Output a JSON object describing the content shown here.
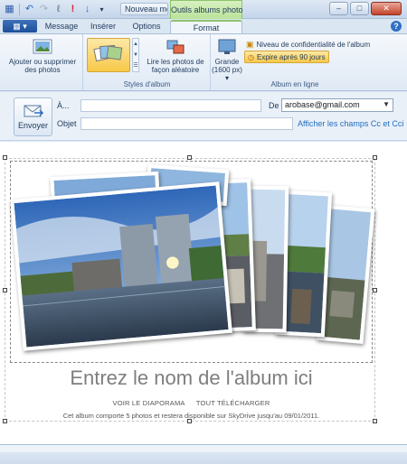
{
  "title_bar": {
    "app_title": "Nouveau me...",
    "context_title": "Outils albums photo"
  },
  "tabs": {
    "message": "Message",
    "inserer": "Insérer",
    "options": "Options",
    "format": "Format"
  },
  "ribbon": {
    "add_remove_label": "Ajouter ou supprimer des photos",
    "styles_group_label": "Styles d'album",
    "random_label": "Lire les photos de façon aléatoire",
    "size_label": "Grande (1600 px)",
    "privacy_label": "Niveau de confidentialité de l'album",
    "expire_label": "Expire après 90 jours",
    "online_group_label": "Album en ligne"
  },
  "header": {
    "send_label": "Envoyer",
    "to_label": "À...",
    "subject_label": "Objet",
    "from_label": "De",
    "from_value": "arobase@gmail.com",
    "cc_link": "Afficher les champs Cc et Cci"
  },
  "album": {
    "title_placeholder": "Entrez le nom de l'album ici",
    "slideshow_link": "VOIR LE DIAPORAMA",
    "download_link": "TOUT TÉLÉCHARGER",
    "note": "Cet album comporte 5 photos et restera disponible sur SkyDrive jusqu'au 09/01/2011."
  },
  "colors": {
    "accent": "#1d4f9b",
    "context_tab": "#b9e39a",
    "link": "#1f6dc0",
    "highlight": "#f7c848"
  }
}
